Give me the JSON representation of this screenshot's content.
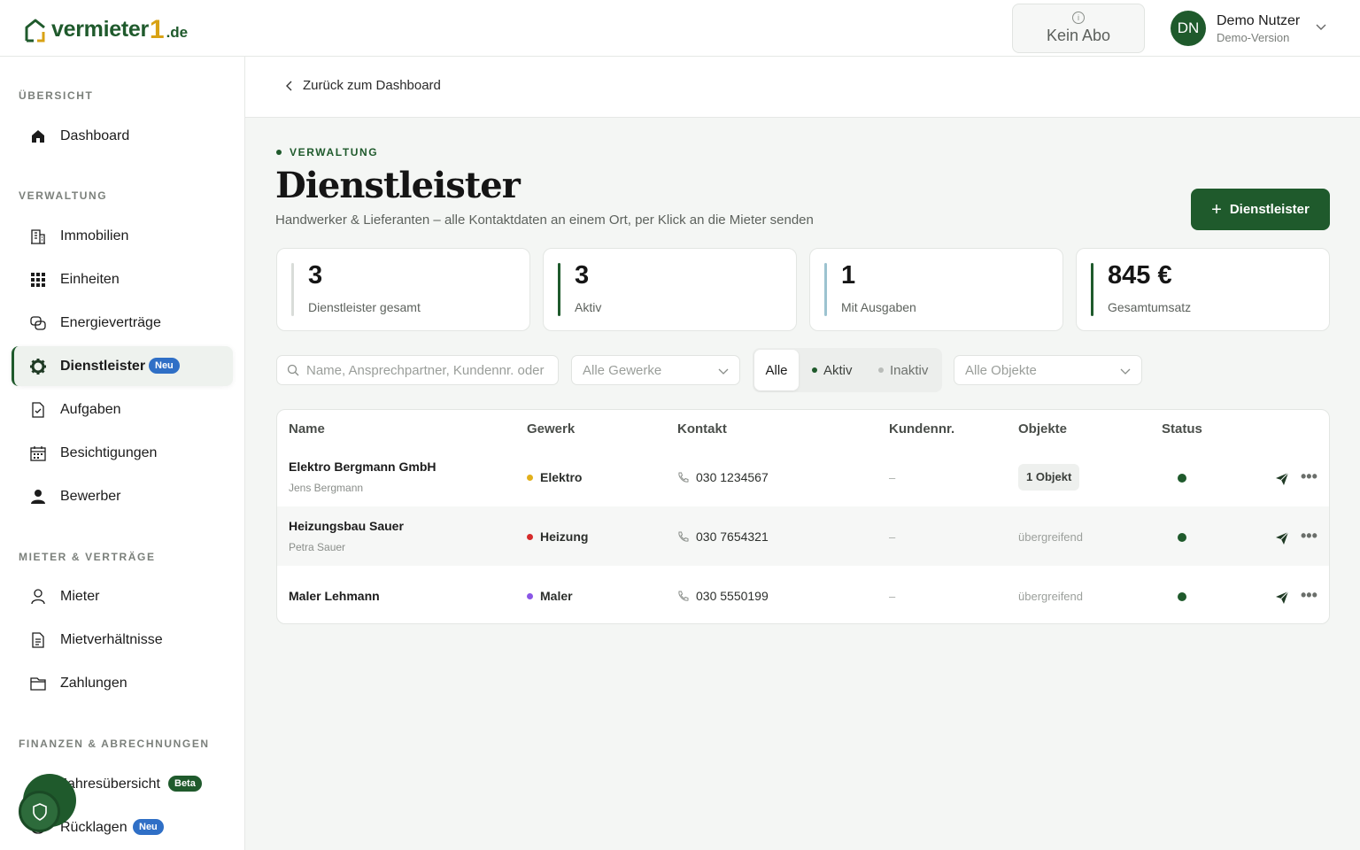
{
  "brand": {
    "name": "vermieter",
    "one": "1",
    "tld": ".de"
  },
  "topbar": {
    "abo_label": "Kein Abo",
    "user_initials": "DN",
    "user_name": "Demo Nutzer",
    "user_sub": "Demo-Version"
  },
  "sidebar": {
    "sections": [
      {
        "title": "ÜBERSICHT"
      },
      {
        "title": "VERWALTUNG"
      },
      {
        "title": "MIETER & VERTRÄGE"
      },
      {
        "title": "FINANZEN & ABRECHNUNGEN"
      }
    ],
    "items": [
      {
        "label": "Dashboard",
        "icon": "home-icon"
      },
      {
        "label": "Immobilien",
        "icon": "building-icon"
      },
      {
        "label": "Einheiten",
        "icon": "grid-icon"
      },
      {
        "label": "Energieverträge",
        "icon": "energy-icon"
      },
      {
        "label": "Dienstleister",
        "icon": "gear-icon",
        "badge": "Neu",
        "active": true
      },
      {
        "label": "Aufgaben",
        "icon": "task-icon"
      },
      {
        "label": "Besichtigungen",
        "icon": "calendar-icon"
      },
      {
        "label": "Bewerber",
        "icon": "person-filled-icon"
      },
      {
        "label": "Mieter",
        "icon": "person-icon"
      },
      {
        "label": "Mietverhältnisse",
        "icon": "document-icon"
      },
      {
        "label": "Zahlungen",
        "icon": "wallet-icon"
      },
      {
        "label": "Jahresübersicht",
        "icon": "chart-icon",
        "badge": "Beta"
      },
      {
        "label": "Rücklagen",
        "icon": "savings-icon",
        "badge": "Neu"
      }
    ]
  },
  "subbar": {
    "back_label": "Zurück zum Dashboard"
  },
  "header": {
    "kicker": "VERWALTUNG",
    "title": "Dienstleister",
    "subtitle": "Handwerker & Lieferanten – alle Kontaktdaten an einem Ort, per Klick an die Mieter senden",
    "add_button": "Dienstleister"
  },
  "stats": [
    {
      "value": "3",
      "label": "Dienstleister gesamt",
      "color": "#d9dcd9"
    },
    {
      "value": "3",
      "label": "Aktiv",
      "color": "#1f5a2c"
    },
    {
      "value": "1",
      "label": "Mit Ausgaben",
      "color": "#9cc3d0"
    },
    {
      "value": "845 €",
      "label": "Gesamtumsatz",
      "color": "#1f5a2c"
    }
  ],
  "filters": {
    "search_placeholder": "Name, Ansprechpartner, Kundennr. oder",
    "gewerke": "Alle Gewerke",
    "objekte": "Alle Objekte",
    "segments": {
      "all": "Alle",
      "active": "Aktiv",
      "inactive": "Inaktiv"
    }
  },
  "table": {
    "columns": [
      "Name",
      "Gewerk",
      "Kontakt",
      "Kundennr.",
      "Objekte",
      "Status"
    ],
    "rows": [
      {
        "name": "Elektro Bergmann GmbH",
        "person": "Jens Bergmann",
        "gewerk": "Elektro",
        "gewerk_color": "#e2b01b",
        "phone": "030 1234567",
        "kundennr": "–",
        "objekte": "1 Objekt",
        "status": "aktiv"
      },
      {
        "name": "Heizungsbau Sauer",
        "person": "Petra Sauer",
        "gewerk": "Heizung",
        "gewerk_color": "#d62b2b",
        "phone": "030 7654321",
        "kundennr": "–",
        "objekte": "übergreifend",
        "status": "aktiv"
      },
      {
        "name": "Maler Lehmann",
        "person": "",
        "gewerk": "Maler",
        "gewerk_color": "#8a56e6",
        "phone": "030 5550199",
        "kundennr": "–",
        "objekte": "übergreifend",
        "status": "aktiv"
      }
    ]
  },
  "colors": {
    "accent": "#1f5a2c",
    "brand_yellow": "#d8a214",
    "badge_blue": "#2f6fc6"
  }
}
